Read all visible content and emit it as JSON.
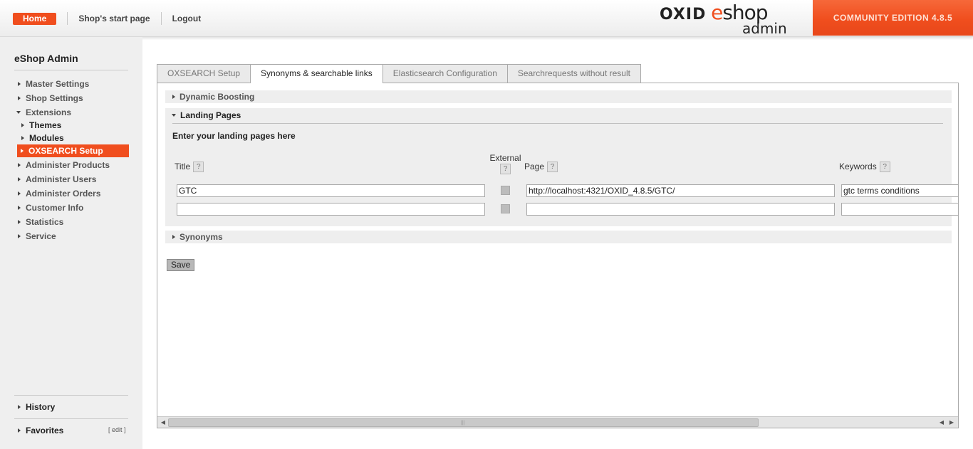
{
  "header": {
    "home": "Home",
    "start_page": "Shop's start page",
    "logout": "Logout",
    "logo": {
      "oxid": "OXID",
      "e": "e",
      "shop": "shop",
      "admin": "admin"
    },
    "edition": "COMMUNITY EDITION 4.8.5"
  },
  "sidebar": {
    "title": "eShop Admin",
    "items": [
      {
        "label": "Master Settings",
        "state": "collapsed"
      },
      {
        "label": "Shop Settings",
        "state": "collapsed"
      },
      {
        "label": "Extensions",
        "state": "expanded"
      },
      {
        "label": "Themes",
        "state": "collapsed"
      },
      {
        "label": "Modules",
        "state": "collapsed"
      },
      {
        "label": "OXSEARCH Setup",
        "state": "active"
      },
      {
        "label": "Administer Products",
        "state": "collapsed"
      },
      {
        "label": "Administer Users",
        "state": "collapsed"
      },
      {
        "label": "Administer Orders",
        "state": "collapsed"
      },
      {
        "label": "Customer Info",
        "state": "collapsed"
      },
      {
        "label": "Statistics",
        "state": "collapsed"
      },
      {
        "label": "Service",
        "state": "collapsed"
      }
    ],
    "history": "History",
    "favorites": "Favorites",
    "edit": "[ edit ]"
  },
  "tabs": [
    {
      "label": "OXSEARCH Setup",
      "active": false
    },
    {
      "label": "Synonyms & searchable links",
      "active": true
    },
    {
      "label": "Elasticsearch Configuration",
      "active": false
    },
    {
      "label": "Searchrequests without result",
      "active": false
    }
  ],
  "sections": {
    "dynamic_boosting": "Dynamic Boosting",
    "landing_pages": "Landing Pages",
    "synonyms": "Synonyms"
  },
  "landing": {
    "intro": "Enter your landing pages here",
    "columns": {
      "title": "Title",
      "external": "External",
      "page": "Page",
      "keywords": "Keywords"
    },
    "help_glyph": "?",
    "rows": [
      {
        "title": "GTC",
        "external": false,
        "page": "http://localhost:4321/OXID_4.8.5/GTC/",
        "keywords": "gtc terms conditions"
      },
      {
        "title": "",
        "external": false,
        "page": "",
        "keywords": ""
      }
    ]
  },
  "save_label": "Save",
  "icons": {
    "collapsed": "triangle-right-icon",
    "expanded": "triangle-down-icon",
    "help": "help-icon"
  }
}
